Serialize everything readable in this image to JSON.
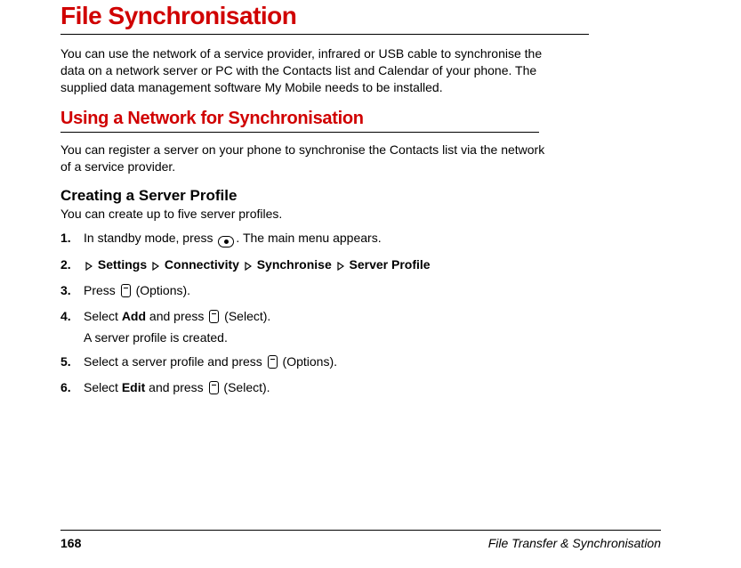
{
  "page_title": "File Synchronisation",
  "intro": "You can use the network of a service provider, infrared or USB cable to synchronise the data on a network server or PC with the Contacts list and Calendar of your phone. The supplied data management software My Mobile needs to be installed.",
  "section": {
    "title": "Using a Network for Synchronisation",
    "intro": "You can register a server on your phone to synchronise the Contacts list via the network of a service provider."
  },
  "subsection": {
    "title": "Creating a Server Profile",
    "intro": "You can create up to five server profiles."
  },
  "steps": {
    "s1a": "In standby mode, press ",
    "s1b": ". The main menu appears.",
    "s2a": "Settings",
    "s2b": "Connectivity",
    "s2c": "Synchronise",
    "s2d": "Server Profile",
    "s3a": "Press ",
    "s3b": " (Options).",
    "s4a": "Select ",
    "s4b": "Add",
    "s4c": " and press ",
    "s4d": " (Select).",
    "s4note": "A server profile is created.",
    "s5a": "Select a server profile and press ",
    "s5b": " (Options).",
    "s6a": "Select ",
    "s6b": "Edit",
    "s6c": " and press ",
    "s6d": " (Select)."
  },
  "footer": {
    "page": "168",
    "section": "File Transfer & Synchronisation"
  }
}
